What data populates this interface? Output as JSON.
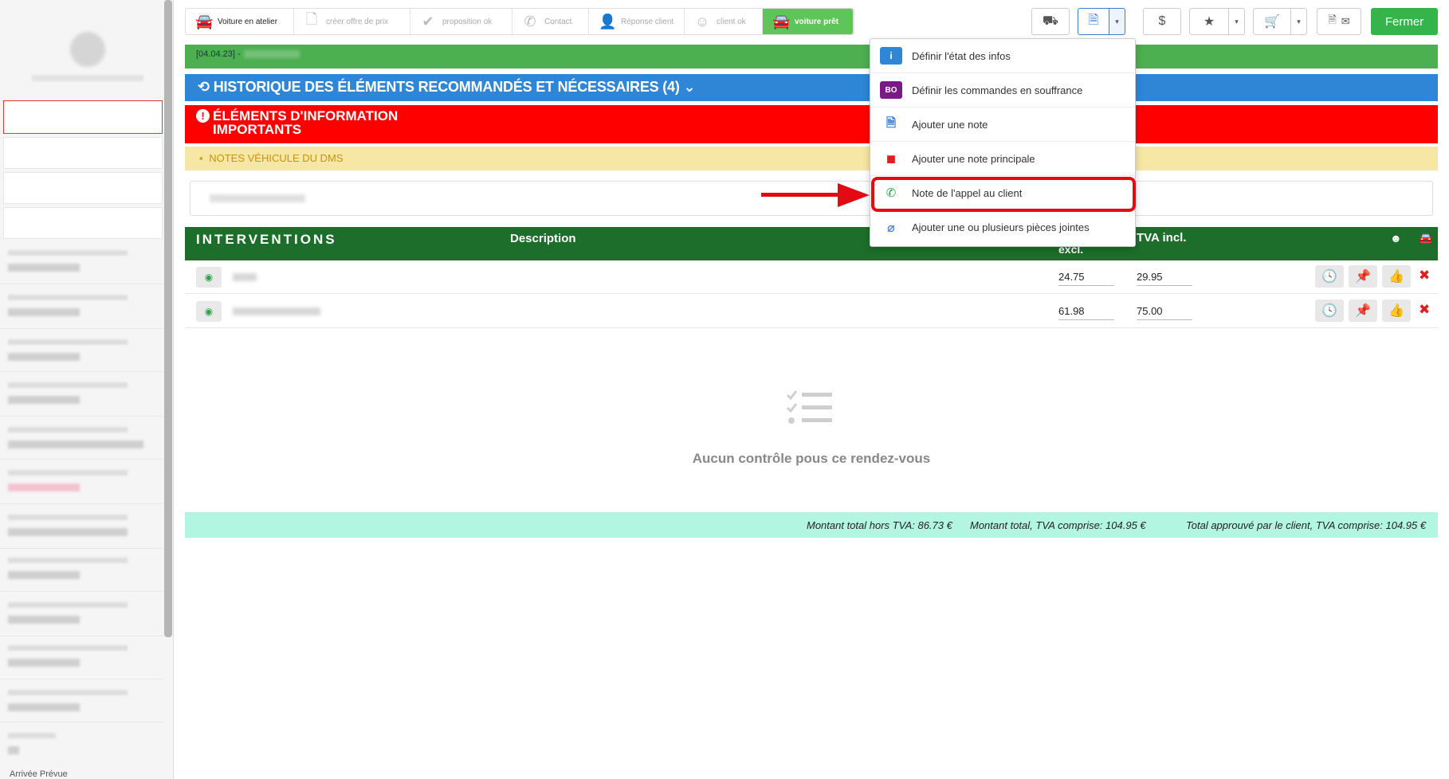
{
  "sidebar": {
    "arrival_label": "Arrivée Prévue"
  },
  "steps": [
    {
      "label": "Voiture en atelier",
      "icon": "car-icon",
      "glyph": "🚘"
    },
    {
      "label": "créer offre de prix",
      "icon": "document-icon",
      "glyph": "🗋"
    },
    {
      "label": "proposition ok",
      "icon": "checkmark-icon",
      "glyph": "✔"
    },
    {
      "label": "Contact",
      "icon": "phone-icon",
      "glyph": "✆"
    },
    {
      "label": "Réponse client",
      "icon": "user-check-icon",
      "glyph": "👤"
    },
    {
      "label": "client ok",
      "icon": "smiley-icon",
      "glyph": "☺"
    },
    {
      "label": "voiture prêt",
      "icon": "car-icon",
      "glyph": "🚘"
    }
  ],
  "toolbar": {
    "close_label": "Fermer",
    "dollar_glyph": "$",
    "star_glyph": "★",
    "cart_glyph": "🛒",
    "truck_glyph": "⛟",
    "file_glyph": "🗎",
    "caret_glyph": "▾",
    "mail_glyph": "✉"
  },
  "date_banner": {
    "date": "[04.04.23] -"
  },
  "history_banner": {
    "label": "HISTORIQUE DES ÉLÉMENTS RECOMMANDÉS ET NÉCESSAIRES (4)",
    "icon_glyph": "⟲",
    "chevron_glyph": "⌄"
  },
  "info_banner": {
    "label": "ÉLÉMENTS D'INFORMATION IMPORTANTS",
    "icon_glyph": "!"
  },
  "dms_banner": {
    "label": "NOTES VÉHICULE DU DMS",
    "icon_glyph": "▪"
  },
  "interventions": {
    "title": "INTERVENTIONS",
    "col_description": "Description",
    "col_excl": "excl.",
    "col_incl": "TVA incl.",
    "icon_smiley": "☻",
    "icon_car": "🚘",
    "rows": [
      {
        "excl": "24.75",
        "incl": "29.95"
      },
      {
        "excl": "61.98",
        "incl": "75.00"
      }
    ],
    "eye_glyph": "◉",
    "clock_glyph": "🕓",
    "pin_glyph": "📌",
    "thumb_glyph": "👍",
    "delete_glyph": "✖"
  },
  "empty_state": {
    "message": "Aucun contrôle pous ce rendez-vous"
  },
  "totals": {
    "excl": "Montant total hors TVA: 86.73 €",
    "incl": "Montant total, TVA comprise: 104.95 €",
    "approved": "Total approuvé par le client, TVA comprise: 104.95 €"
  },
  "dropdown": {
    "items": [
      {
        "label": "Définir l'état des infos",
        "icon": "info-icon",
        "glyph": "i"
      },
      {
        "label": "Définir les commandes en souffrance",
        "icon": "backorder-icon",
        "glyph": "BO"
      },
      {
        "label": "Ajouter une note",
        "icon": "note-icon",
        "glyph": "🗎"
      },
      {
        "label": "Ajouter une note principale",
        "icon": "main-note-icon",
        "glyph": "◼"
      },
      {
        "label": "Note de l'appel au client",
        "icon": "phone-icon",
        "glyph": "✆"
      },
      {
        "label": "Ajouter une ou plusieurs pièces jointes",
        "icon": "paperclip-icon",
        "glyph": "⌀"
      }
    ]
  },
  "colors": {
    "accent_green": "#34b44a",
    "banner_blue": "#2f86d6",
    "banner_red": "#ff0000",
    "highlight_red": "#e50914"
  }
}
